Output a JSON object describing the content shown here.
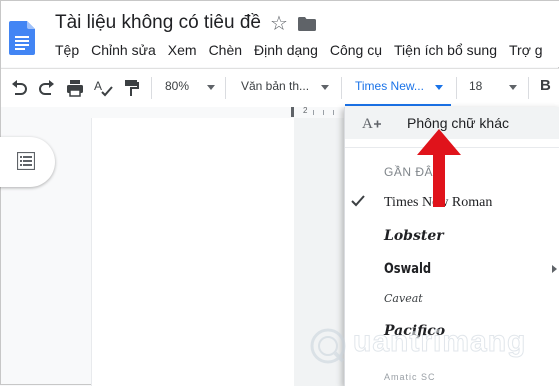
{
  "header": {
    "title": "Tài liệu không có tiêu đề"
  },
  "menubar": {
    "items": [
      "Tệp",
      "Chỉnh sửa",
      "Xem",
      "Chèn",
      "Định dạng",
      "Công cụ",
      "Tiện ích bổ sung",
      "Trợ g"
    ]
  },
  "toolbar": {
    "zoom": "80%",
    "style": "Văn bản th...",
    "font": "Times New...",
    "font_size": "18",
    "bold": "B",
    "font_accent": "#1a73e8"
  },
  "ruler": {
    "marker": "2"
  },
  "font_menu": {
    "more_fonts": "Phông chữ khác",
    "recent_header": "GẦN ĐÂY",
    "recent_fonts": [
      "Times New Roman",
      "Lobster",
      "Oswald",
      "Caveat",
      "Pacifico",
      "Amatic SC"
    ],
    "selected_font": "Times New Roman"
  },
  "annotation": {
    "arrow_color": "#e0131b"
  },
  "watermark": {
    "text": "uantrimang",
    "logo": "Q"
  }
}
